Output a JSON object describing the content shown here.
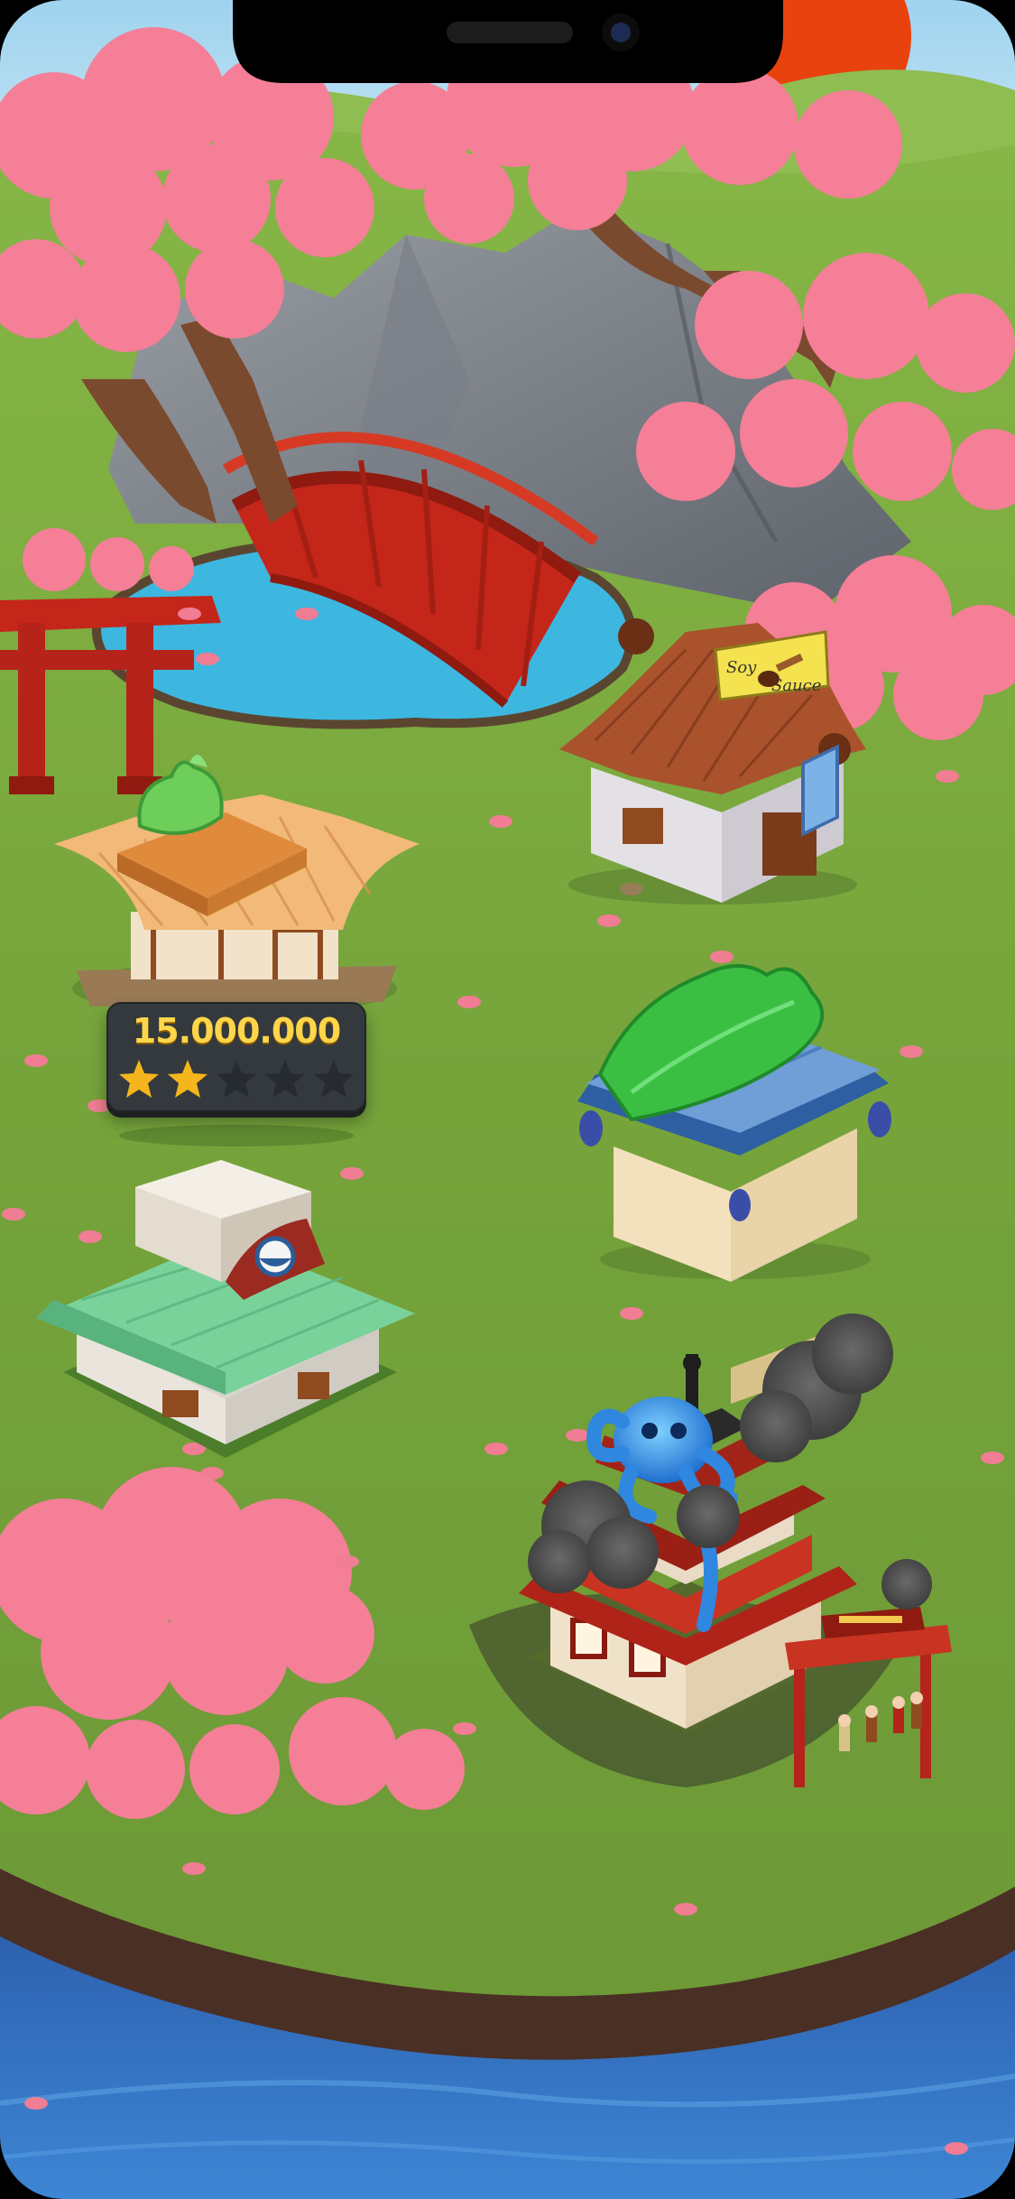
{
  "game": {
    "screen": "island-map",
    "colors": {
      "grass": "#7aa93e",
      "pond": "#3db7e0",
      "sea": "#2f6fc0",
      "blossom": "#f47f97",
      "bridge": "#c4261a",
      "score_text": "#ffd64a",
      "star_filled": "#f5b51c",
      "star_empty": "#252b30"
    }
  },
  "wasabi_shop": {
    "price": "15.000.000",
    "rating": 2,
    "max_rating": 5
  },
  "soy_shop": {
    "sign_line1": "Soy",
    "sign_line2": "Sauce"
  },
  "buildings": [
    {
      "id": "wasabi-shop",
      "icon": "wasabi-building-icon"
    },
    {
      "id": "soy-sauce-shop",
      "icon": "soy-sauce-building-icon"
    },
    {
      "id": "seaweed-shop",
      "icon": "nori-building-icon"
    },
    {
      "id": "rice-shop",
      "icon": "rice-building-icon"
    },
    {
      "id": "restaurant",
      "icon": "burning-restaurant-icon"
    }
  ]
}
